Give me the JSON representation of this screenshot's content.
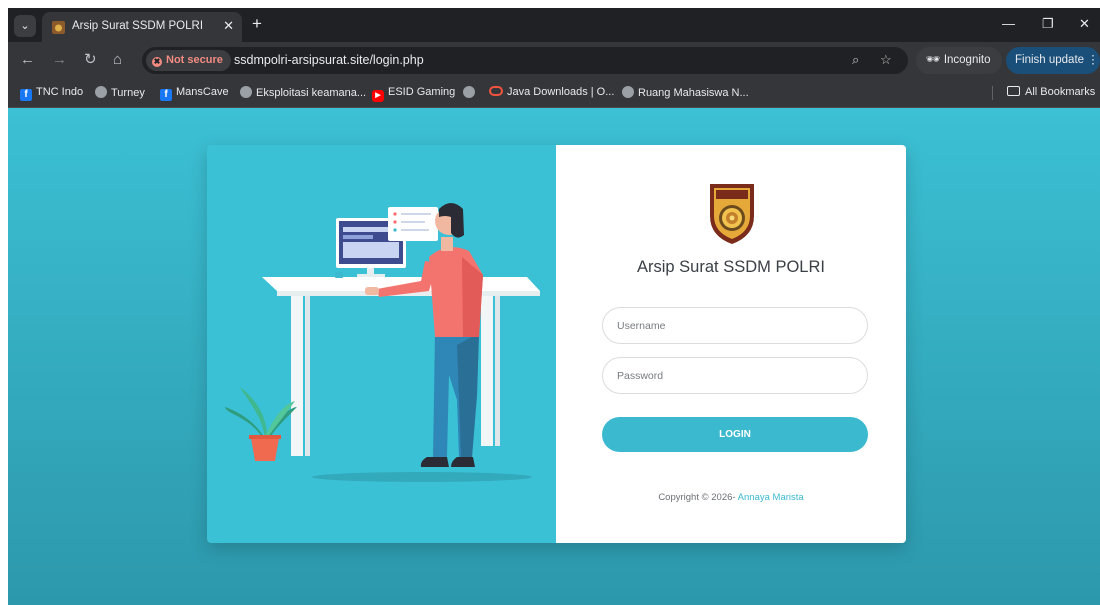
{
  "browser": {
    "tab": {
      "title": "Arsip Surat SSDM POLRI"
    },
    "new_tab_symbol": "+",
    "url": "ssdmpolri-arsipsurat.site/login.php",
    "security_chip": "Not secure",
    "incognito_label": "Incognito",
    "update_label": "Finish update",
    "bookmarks": [
      {
        "label": "TNC Indo",
        "icon": "facebook-icon"
      },
      {
        "label": "Turney",
        "icon": "globe-icon"
      },
      {
        "label": "MansCave",
        "icon": "facebook-icon"
      },
      {
        "label": "Eksploitasi keamana...",
        "icon": "globe-icon"
      },
      {
        "label": "ESID Gaming",
        "icon": "youtube-icon"
      },
      {
        "label": "",
        "icon": "globe-icon"
      },
      {
        "label": "Java Downloads | O...",
        "icon": "oracle-icon"
      },
      {
        "label": "Ruang Mahasiswa N...",
        "icon": "globe-icon"
      }
    ],
    "all_bookmarks_label": "All Bookmarks"
  },
  "login": {
    "title": "Arsip Surat SSDM POLRI",
    "username_placeholder": "Username",
    "password_placeholder": "Password",
    "button_label": "LOGIN",
    "copyright_prefix": "Copyright © 2026-",
    "copyright_author": "Annaya Marista"
  },
  "colors": {
    "page_gradient_top": "#3cc0d4",
    "page_gradient_bottom": "#2d98ac",
    "illustration_bg": "#3bc1d5",
    "accent": "#3bb9cf",
    "browser_dark": "#202124",
    "browser_toolbar": "#35363a"
  }
}
